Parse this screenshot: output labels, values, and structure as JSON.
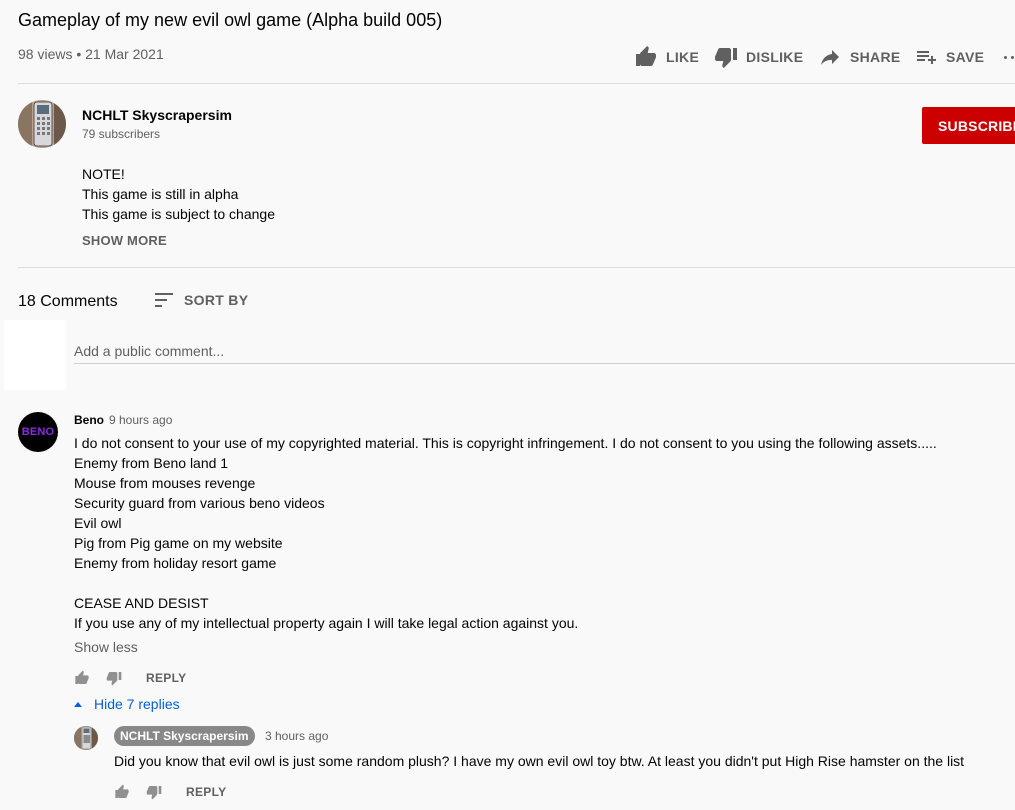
{
  "video": {
    "title": "Gameplay of my new evil owl game (Alpha build 005)",
    "meta": "98 views • 21 Mar 2021",
    "actions": {
      "like": "LIKE",
      "dislike": "DISLIKE",
      "share": "SHARE",
      "save": "SAVE"
    }
  },
  "channel": {
    "name": "NCHLT Skyscrapersim",
    "subscribers": "79 subscribers",
    "subscribe_label": "SUBSCRIBE",
    "description": [
      "NOTE!",
      "This game is still in alpha",
      "This game is subject to change"
    ],
    "show_more": "SHOW MORE"
  },
  "comments": {
    "count_label": "18 Comments",
    "sort_label": "SORT BY",
    "input_placeholder": "Add a public comment...",
    "thread": {
      "author": "Beno",
      "avatar_text": "BENO",
      "time": "9 hours ago",
      "lines": [
        "I do not consent to your use of my copyrighted material.  This is copyright infringement.   I do not consent to you using the following assets.....",
        "Enemy from Beno land 1",
        "Mouse from mouses revenge",
        "Security guard from various beno videos",
        "Evil owl",
        "Pig from Pig game on my website",
        "Enemy from holiday resort game",
        "",
        "CEASE AND DESIST",
        "If you use any of my intellectual property again I will take legal action against you."
      ],
      "show_less": "Show less",
      "reply_label": "REPLY",
      "hide_replies": "Hide 7 replies"
    },
    "reply": {
      "author": "NCHLT Skyscrapersim",
      "time": "3 hours ago",
      "text": "Did you know that evil owl is just some random plush? I have my own evil owl toy btw. At least you didn't put High Rise hamster on the list",
      "reply_label": "REPLY"
    }
  },
  "colors": {
    "subscribe": "#cc0000",
    "link": "#065fd4",
    "beno_text": "#8a2be2",
    "owner_badge": "#888888"
  }
}
